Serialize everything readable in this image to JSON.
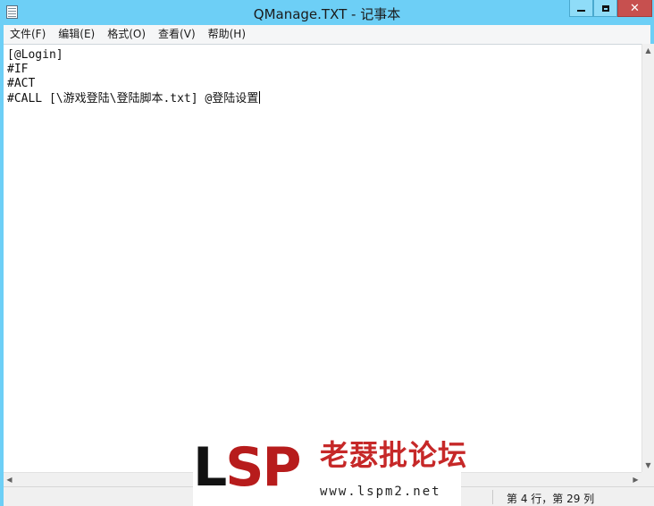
{
  "window": {
    "title": "QManage.TXT - 记事本",
    "minimize_icon": "minimize-icon",
    "maximize_icon": "maximize-icon",
    "close_icon": "close-icon",
    "close_glyph": "✕"
  },
  "menu": {
    "items": [
      {
        "label": "文件(F)"
      },
      {
        "label": "编辑(E)"
      },
      {
        "label": "格式(O)"
      },
      {
        "label": "查看(V)"
      },
      {
        "label": "帮助(H)"
      }
    ]
  },
  "editor": {
    "content": "[@Login]\n#IF\n#ACT\n#CALL [\\游戏登陆\\登陆脚本.txt] @登陆设置"
  },
  "scrollbars": {
    "up": "▲",
    "down": "▼",
    "left": "◀",
    "right": "▶"
  },
  "status": {
    "position": "第 4 行，第 29 列"
  },
  "watermark": {
    "letters_l": "L",
    "letters_sp": "SP",
    "site_name": "老瑟批论坛",
    "url": "www.lspm2.net"
  },
  "colors": {
    "titlebar": "#6dcff6",
    "close_button": "#c7504f",
    "logo_red": "#c62828"
  }
}
